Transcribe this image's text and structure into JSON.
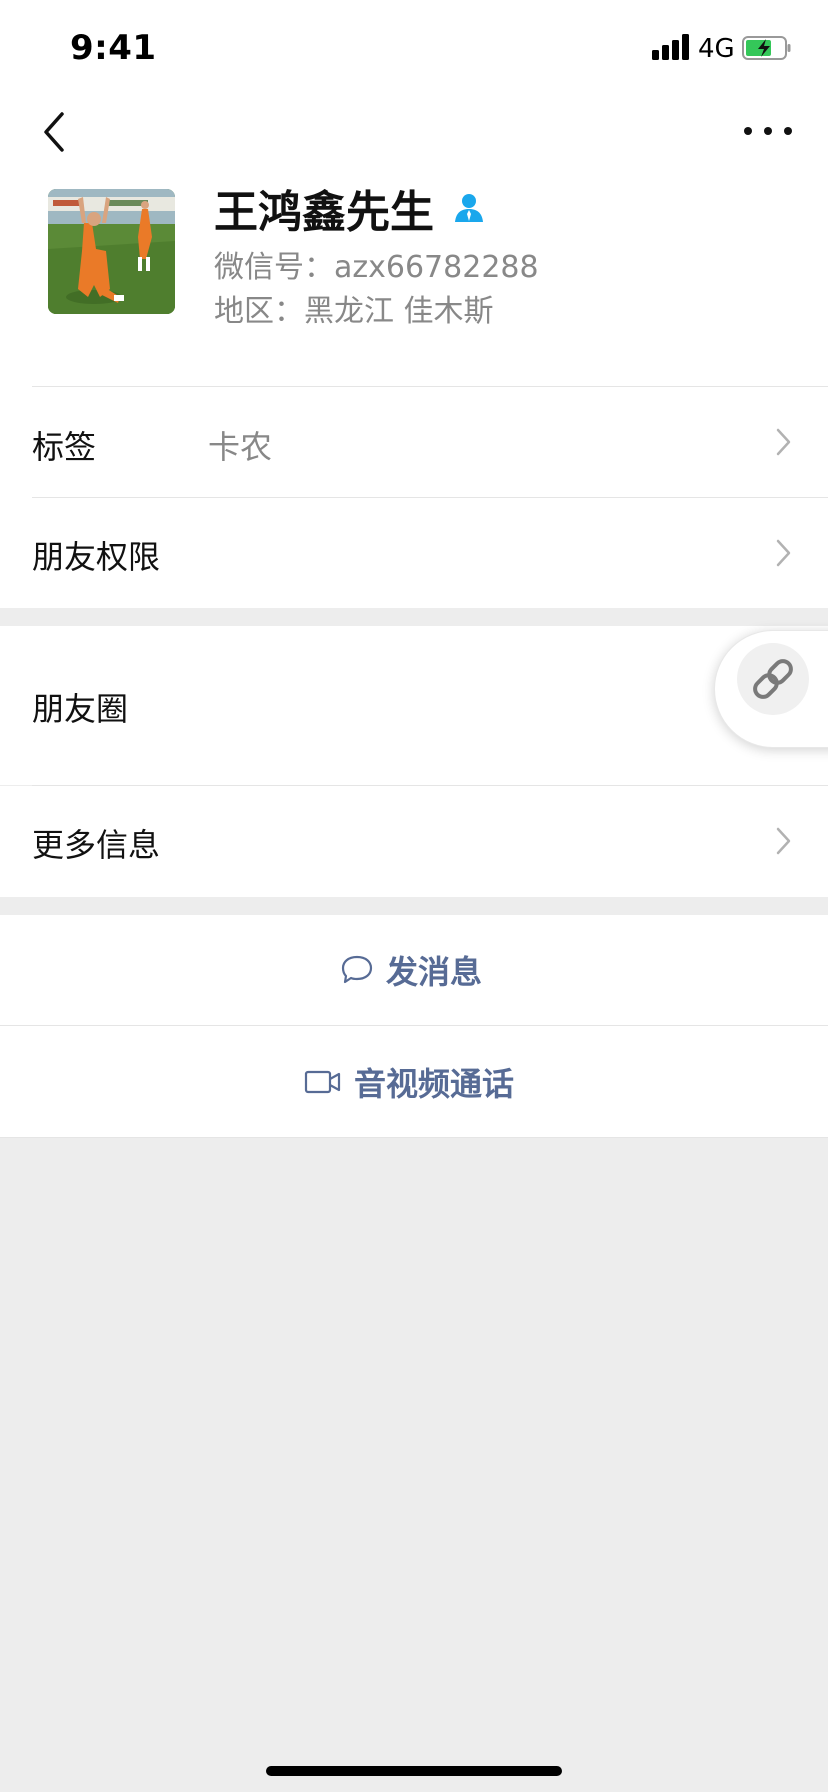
{
  "status_bar": {
    "time": "9:41",
    "network": "4G",
    "icons": [
      "signal-icon",
      "battery-charging-icon"
    ]
  },
  "nav": {
    "back_icon": "chevron-left-icon",
    "more_icon": "more-dots-icon"
  },
  "profile": {
    "name": "王鸿鑫先生",
    "contact_icon": "person-icon",
    "wechat_id": "微信号：azx66782288",
    "region": "地区：黑龙江 佳木斯",
    "avatar_desc": "football-player-photo"
  },
  "cells": {
    "tag": {
      "title": "标签",
      "value": "卡农"
    },
    "permissions": {
      "title": "朋友权限"
    },
    "moments": {
      "title": "朋友圈"
    },
    "more_info": {
      "title": "更多信息"
    }
  },
  "floating_button": {
    "icon": "link-icon"
  },
  "actions": {
    "message": {
      "label": "发消息",
      "icon": "chat-bubble-icon"
    },
    "call": {
      "label": "音视频通话",
      "icon": "video-camera-icon"
    }
  },
  "colors": {
    "accent_link": "#576b95",
    "contact_icon": "#1aa7ec",
    "battery_green": "#34c759",
    "background": "#ededed"
  }
}
